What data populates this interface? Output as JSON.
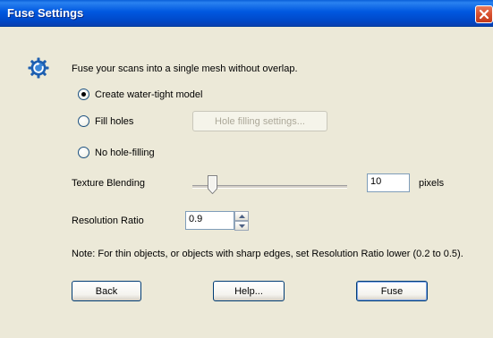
{
  "window": {
    "title": "Fuse Settings"
  },
  "intro_text": "Fuse your scans into a single mesh without overlap.",
  "options": {
    "water_tight": {
      "label": "Create water-tight model",
      "checked": true
    },
    "fill_holes": {
      "label": "Fill holes",
      "checked": false
    },
    "no_hole_filling": {
      "label": "No hole-filling",
      "checked": false
    }
  },
  "hole_filling_button": "Hole filling settings...",
  "texture_blending": {
    "label": "Texture Blending",
    "value": "10",
    "unit": "pixels"
  },
  "resolution_ratio": {
    "label": "Resolution Ratio",
    "value": "0.9"
  },
  "note": "Note:  For thin objects, or objects with sharp edges, set Resolution Ratio lower (0.2 to 0.5).",
  "buttons": {
    "back": "Back",
    "help": "Help...",
    "fuse": "Fuse"
  },
  "icons": {
    "app": "gear-refresh-icon",
    "close": "close-icon"
  }
}
